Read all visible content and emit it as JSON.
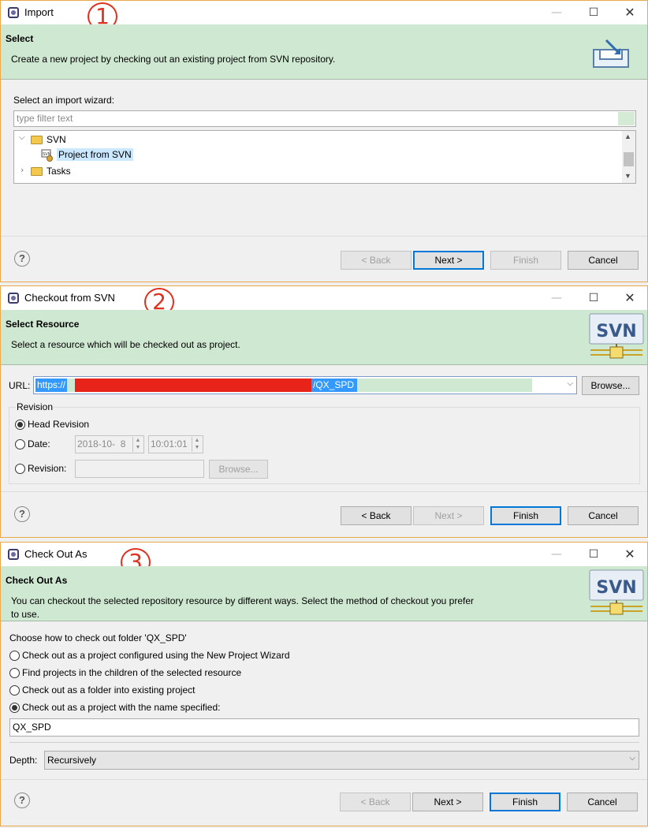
{
  "dialog1": {
    "step": "1",
    "title": "Import",
    "banner_title": "Select",
    "banner_desc": "Create a new project by checking out an existing project from SVN repository.",
    "wizard_label": "Select an import wizard:",
    "filter_placeholder": "type filter text",
    "tree": [
      {
        "label": "SVN",
        "expanded": true
      },
      {
        "label": "Project from SVN",
        "selected": true
      },
      {
        "label": "Tasks",
        "expanded": false
      }
    ],
    "buttons": {
      "back": "< Back",
      "next": "Next >",
      "finish": "Finish",
      "cancel": "Cancel"
    }
  },
  "dialog2": {
    "step": "2",
    "title": "Checkout from SVN",
    "banner_title": "Select Resource",
    "banner_desc": "Select a resource which will be checked out as project.",
    "svn_logo_text": "SVN",
    "url_label": "URL:",
    "url_prefix": "https://",
    "url_suffix": "/QX_SPD",
    "browse_label": "Browse...",
    "revision_group": "Revision",
    "head_revision_label": "Head Revision",
    "date_label": "Date:",
    "date_value": "2018-10-  8",
    "time_value": "10:01:01",
    "revision_label": "Revision:",
    "revision_browse": "Browse...",
    "buttons": {
      "back": "< Back",
      "next": "Next >",
      "finish": "Finish",
      "cancel": "Cancel"
    }
  },
  "dialog3": {
    "step": "3",
    "title": "Check Out As",
    "banner_title": "Check Out As",
    "banner_desc": "You can checkout the selected repository resource by different ways. Select the method of checkout you prefer to use.",
    "svn_logo_text": "SVN",
    "choose_label": "Choose how to check out folder 'QX_SPD'",
    "options": [
      "Check out as a project configured using the New Project Wizard",
      "Find projects in the children of the selected resource",
      "Check out as a folder into existing project",
      "Check out as a project with the name specified:"
    ],
    "selected_option": 3,
    "project_name": "QX_SPD",
    "depth_label": "Depth:",
    "depth_value": "Recursively",
    "buttons": {
      "back": "< Back",
      "next": "Next >",
      "finish": "Finish",
      "cancel": "Cancel"
    }
  },
  "colors": {
    "banner_bg": "#cfe8d1",
    "accent": "#0078d7",
    "selection": "#cce8ff",
    "redaction": "#e8231a",
    "step_badge": "#e0301e"
  }
}
